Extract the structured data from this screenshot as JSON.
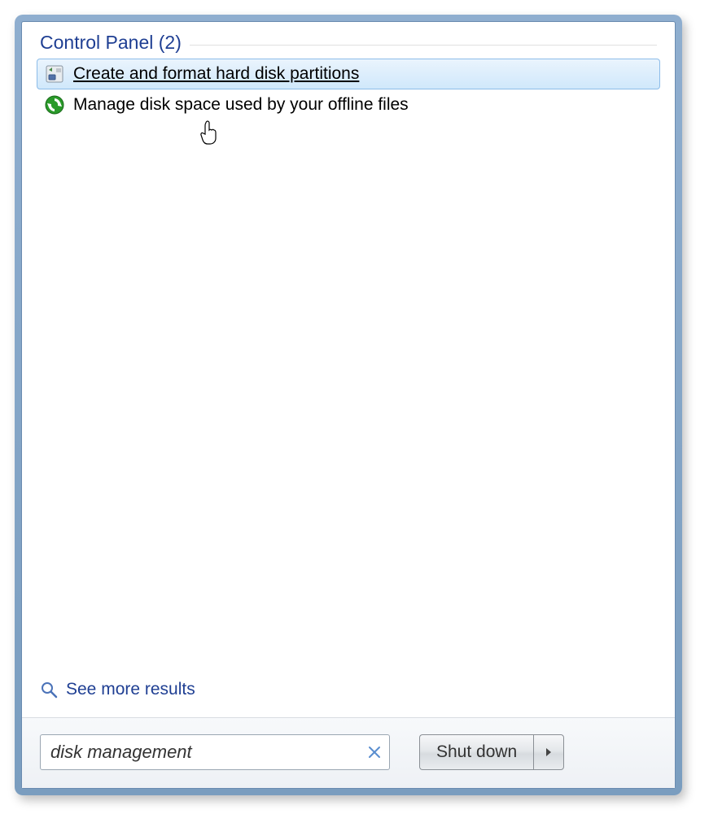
{
  "category": {
    "title": "Control Panel (2)"
  },
  "results": [
    {
      "label": "Create and format hard disk partitions"
    },
    {
      "label": "Manage disk space used by your offline files"
    }
  ],
  "seeMore": {
    "label": "See more results"
  },
  "search": {
    "value": "disk management"
  },
  "shutdown": {
    "label": "Shut down"
  }
}
